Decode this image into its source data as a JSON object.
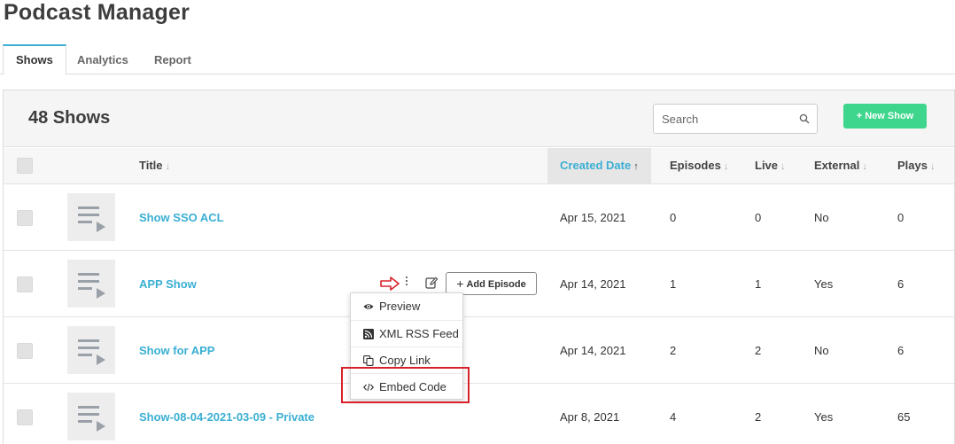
{
  "app": {
    "title": "Podcast Manager"
  },
  "tabs": [
    {
      "label": "Shows",
      "active": true
    },
    {
      "label": "Analytics",
      "active": false
    },
    {
      "label": "Report",
      "active": false
    }
  ],
  "panel": {
    "count_label": "48 Shows",
    "search": {
      "placeholder": "Search",
      "value": ""
    },
    "new_show_label": "+ New Show",
    "accent_color": "#3ed68c"
  },
  "table": {
    "columns": {
      "title": "Title",
      "created_date": "Created Date",
      "episodes": "Episodes",
      "live": "Live",
      "external": "External",
      "plays": "Plays"
    },
    "sort_arrow": "↓",
    "sorted_arrow": "↑",
    "rows": [
      {
        "title": "Show SSO ACL",
        "created": "Apr 15, 2021",
        "episodes": "0",
        "live": "0",
        "external": "No",
        "plays": "0"
      },
      {
        "title": "APP Show",
        "created": "Apr 14, 2021",
        "episodes": "1",
        "live": "1",
        "external": "Yes",
        "plays": "6"
      },
      {
        "title": "Show for APP",
        "created": "Apr 14, 2021",
        "episodes": "2",
        "live": "2",
        "external": "No",
        "plays": "6"
      },
      {
        "title": "Show-08-04-2021-03-09 - Private",
        "created": "Apr 8, 2021",
        "episodes": "4",
        "live": "2",
        "external": "Yes",
        "plays": "65"
      }
    ],
    "row_actions": {
      "add_episode_label": "Add Episode"
    }
  },
  "dropdown": {
    "items": [
      {
        "label": "Preview",
        "icon": "eye-icon"
      },
      {
        "label": "XML RSS Feed",
        "icon": "rss-icon"
      },
      {
        "label": "Copy Link",
        "icon": "copy-icon"
      },
      {
        "label": "Embed Code",
        "icon": "code-icon"
      }
    ]
  },
  "colors": {
    "link": "#3aafd3",
    "highlight": "#d8222a"
  }
}
